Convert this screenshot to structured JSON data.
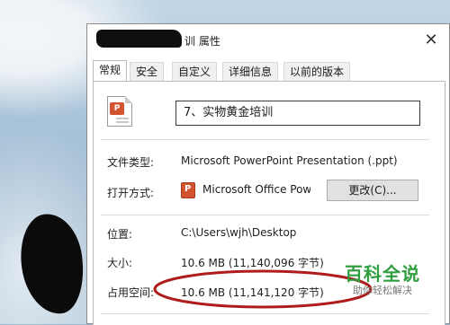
{
  "dialog": {
    "title": "训 属性",
    "close_glyph": "✕"
  },
  "tabs": [
    {
      "label": "常规",
      "active": true
    },
    {
      "label": "安全"
    },
    {
      "label": "自定义"
    },
    {
      "label": "详细信息"
    },
    {
      "label": "以前的版本"
    }
  ],
  "file": {
    "icon": "powerpoint-file-icon",
    "name": "7、实物黄金培训"
  },
  "props": {
    "type_label": "文件类型:",
    "type_value": "Microsoft PowerPoint Presentation (.ppt)",
    "open_label": "打开方式:",
    "open_value": "Microsoft Office Powe",
    "change_button": "更改(C)...",
    "location_label": "位置:",
    "location_value": "C:\\Users\\wjh\\Desktop",
    "size_label": "大小:",
    "size_value": "10.6 MB (11,140,096 字节)",
    "disk_label": "占用空间:",
    "disk_value": "10.6 MB (11,141,120 字节)"
  },
  "watermark": {
    "title": "百科全说",
    "subtitle": "助你轻松解决"
  },
  "colors": {
    "ppt_accent": "#d35230",
    "annotation_red": "#b01c1c",
    "watermark_green": "#2e9e3e"
  }
}
